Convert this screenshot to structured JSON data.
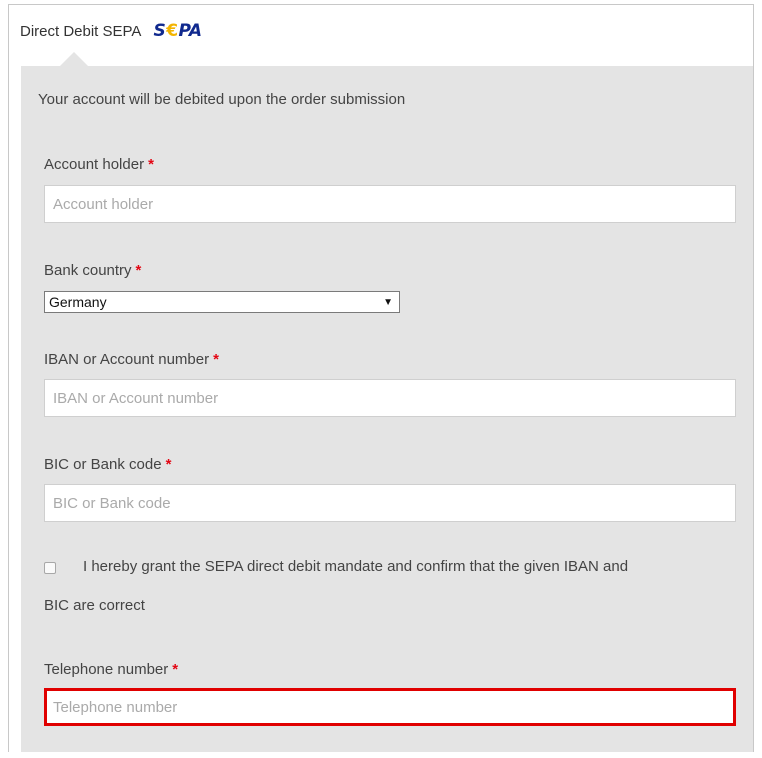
{
  "header": {
    "title": "Direct Debit SEPA",
    "logo_text_left": "S",
    "logo_text_euro": "€",
    "logo_text_right": "PA"
  },
  "info_text": "Your account will be debited upon the order submission",
  "form": {
    "required_marker": "*",
    "account_holder": {
      "label": "Account holder",
      "placeholder": "Account holder"
    },
    "bank_country": {
      "label": "Bank country",
      "value": "Germany"
    },
    "iban": {
      "label": "IBAN or Account number",
      "placeholder": "IBAN or Account number"
    },
    "bic": {
      "label": "BIC or Bank code",
      "placeholder": "BIC or Bank code"
    },
    "mandate": {
      "checked": false,
      "text_line1": "I hereby grant the SEPA direct debit mandate and confirm that the given IBAN and",
      "text_line2": "BIC are correct"
    },
    "telephone": {
      "label": "Telephone number",
      "placeholder": "Telephone number"
    }
  },
  "colors": {
    "panel_bg": "#e4e4e4",
    "required": "#e30613",
    "highlight_border": "#e00000",
    "sepa_blue": "#10298e",
    "sepa_yellow": "#f3b400"
  }
}
